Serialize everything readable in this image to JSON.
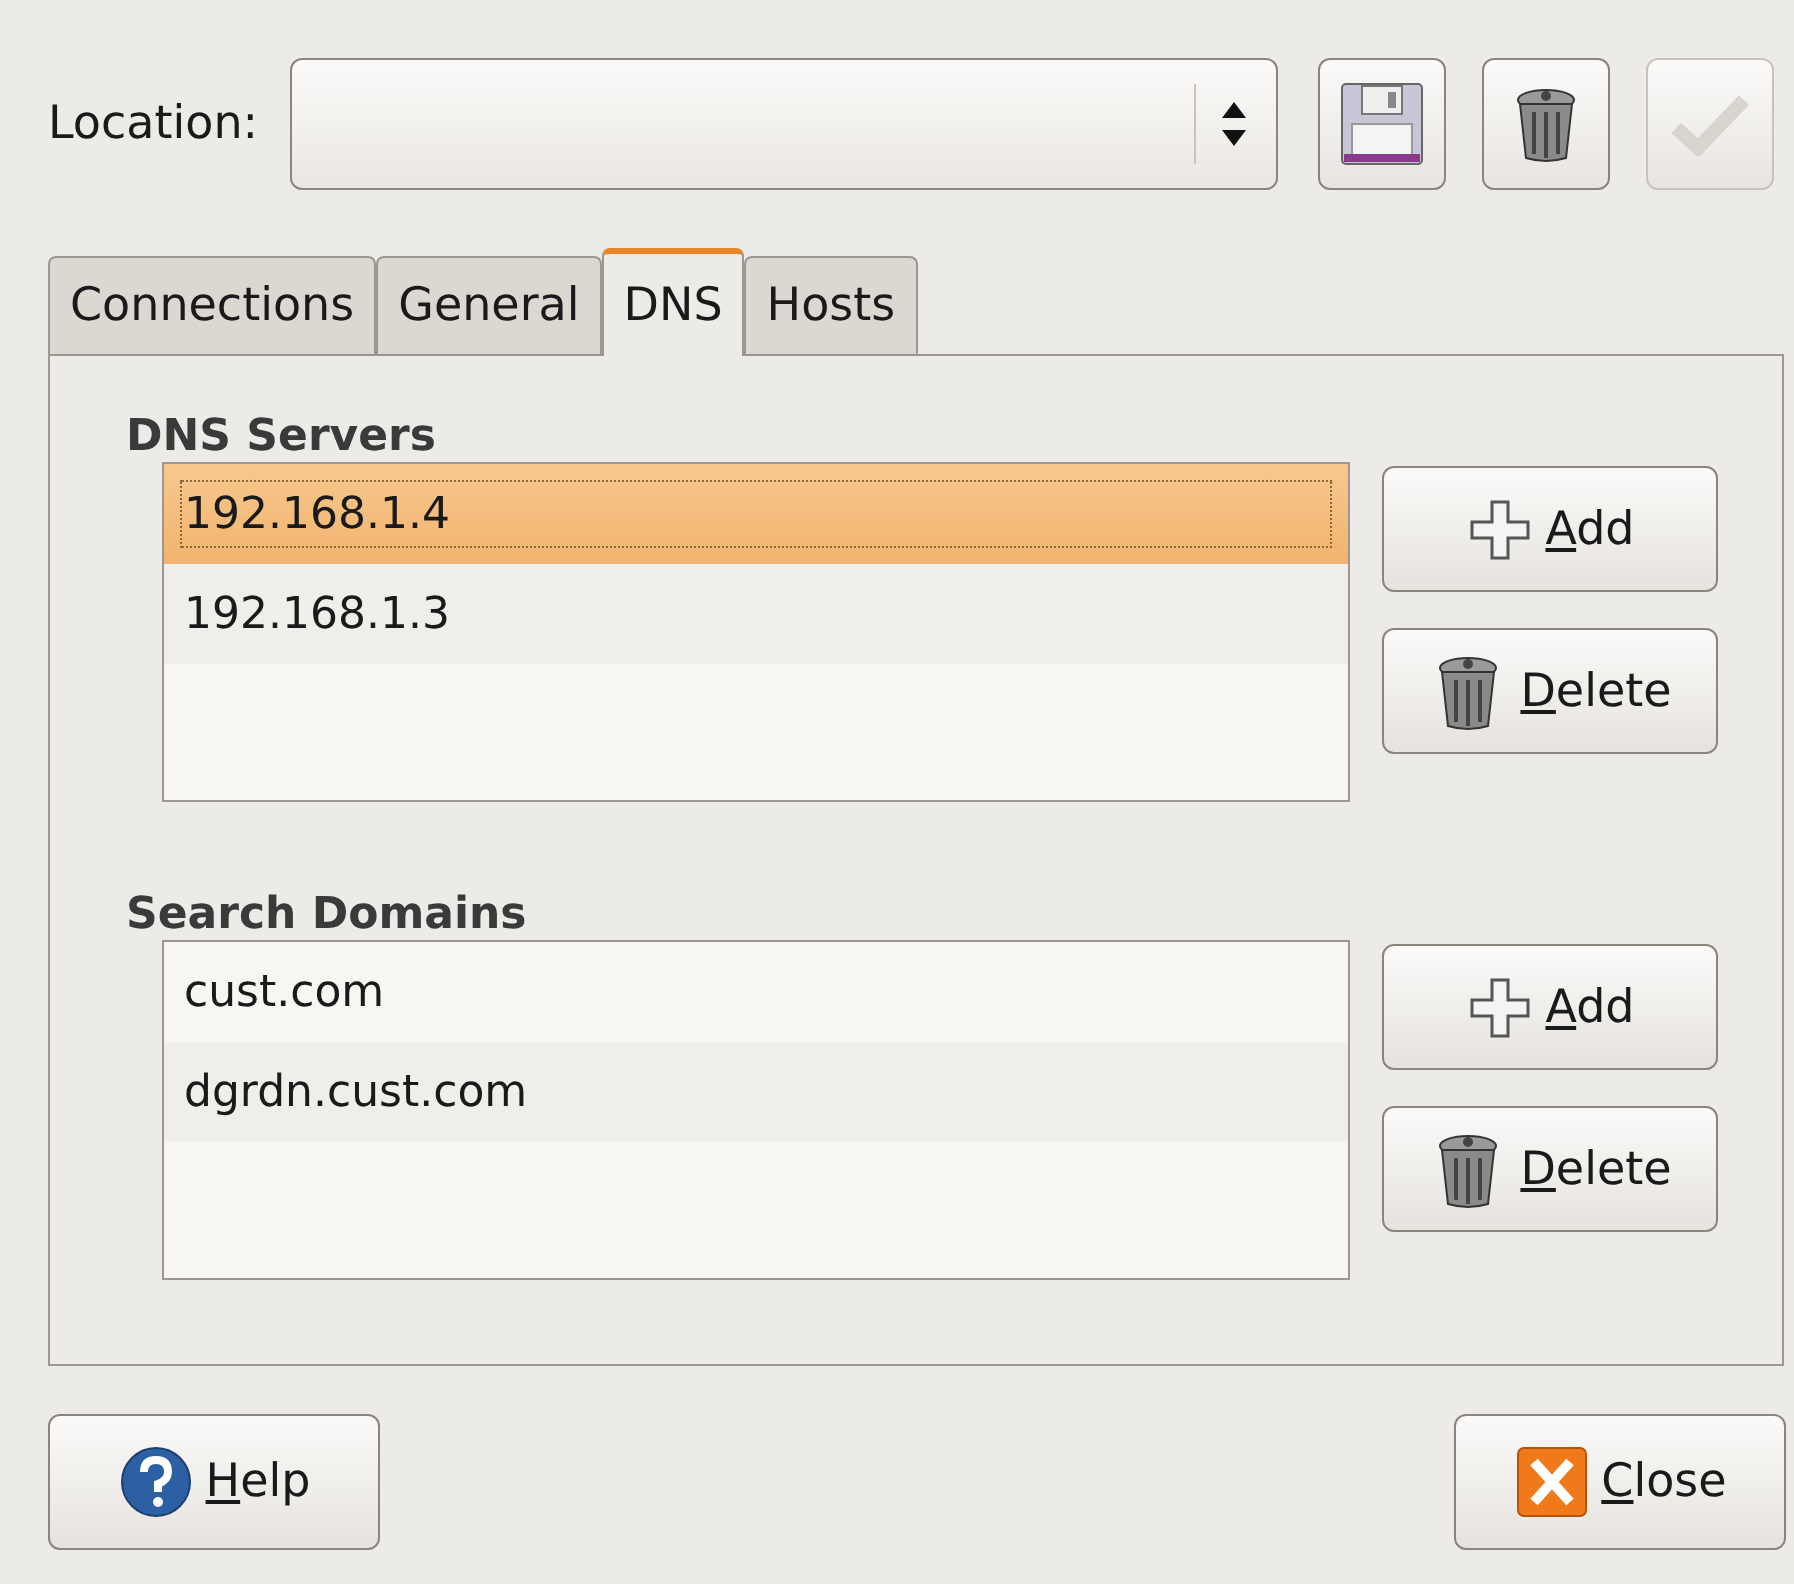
{
  "location": {
    "label": "Location:",
    "buttons": [
      {
        "kind": "save",
        "disabled": false
      },
      {
        "kind": "delete",
        "disabled": false
      },
      {
        "kind": "apply",
        "disabled": true
      }
    ]
  },
  "tabs": [
    {
      "label": "Connections",
      "selected": false
    },
    {
      "label": "General",
      "selected": false
    },
    {
      "label": "DNS",
      "selected": true
    },
    {
      "label": "Hosts",
      "selected": false
    }
  ],
  "sections": [
    {
      "title": "DNS Servers",
      "items": [
        {
          "text": "192.168.1.4",
          "selected": true
        },
        {
          "text": "192.168.1.3",
          "selected": false
        }
      ],
      "buttons": [
        {
          "kind": "add",
          "label": "Add",
          "mnemonic": true
        },
        {
          "kind": "delete",
          "label": "Delete",
          "mnemonic": true
        }
      ]
    },
    {
      "title": "Search Domains",
      "items": [
        {
          "text": "cust.com",
          "selected": false
        },
        {
          "text": "dgrdn.cust.com",
          "selected": false
        }
      ],
      "buttons": [
        {
          "kind": "add",
          "label": "Add",
          "mnemonic": true
        },
        {
          "kind": "delete",
          "label": "Delete",
          "mnemonic": true
        }
      ]
    }
  ],
  "footer": [
    {
      "kind": "help",
      "label": "Help",
      "mnemonic": true
    },
    {
      "kind": "close",
      "label": "Close",
      "mnemonic": true
    }
  ]
}
